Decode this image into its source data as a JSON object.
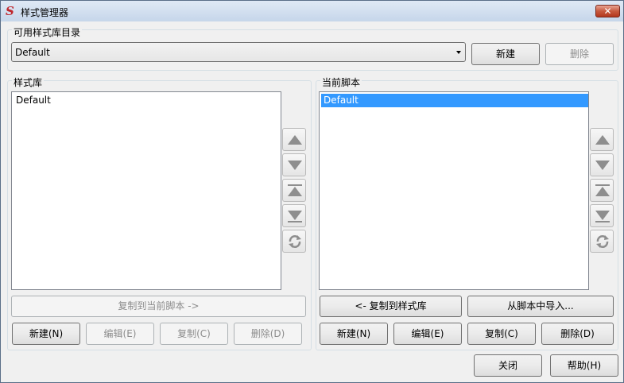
{
  "window": {
    "title": "样式管理器",
    "close_label": "✕"
  },
  "library_dir": {
    "label": "可用样式库目录",
    "selected": "Default",
    "new_label": "新建",
    "delete_label": "删除"
  },
  "style_library": {
    "label": "样式库",
    "items": [
      {
        "label": "Default",
        "selected": false
      }
    ],
    "copy_to_script_label": "复制到当前脚本 ->",
    "new_label": "新建(N)",
    "edit_label": "编辑(E)",
    "copy_label": "复制(C)",
    "delete_label": "删除(D)"
  },
  "current_script": {
    "label": "当前脚本",
    "items": [
      {
        "label": "Default",
        "selected": true
      }
    ],
    "copy_to_library_label": "<- 复制到样式库",
    "import_label": "从脚本中导入...",
    "new_label": "新建(N)",
    "edit_label": "编辑(E)",
    "copy_label": "复制(C)",
    "delete_label": "删除(D)"
  },
  "side_buttons": [
    "move-up-icon",
    "move-down-icon",
    "move-top-icon",
    "move-bottom-icon",
    "sort-icon"
  ],
  "footer": {
    "close_label": "关闭",
    "help_label": "帮助(H)"
  },
  "colors": {
    "selection": "#3399ff",
    "close_button": "#c75a3f",
    "app_icon": "#c0262d"
  }
}
